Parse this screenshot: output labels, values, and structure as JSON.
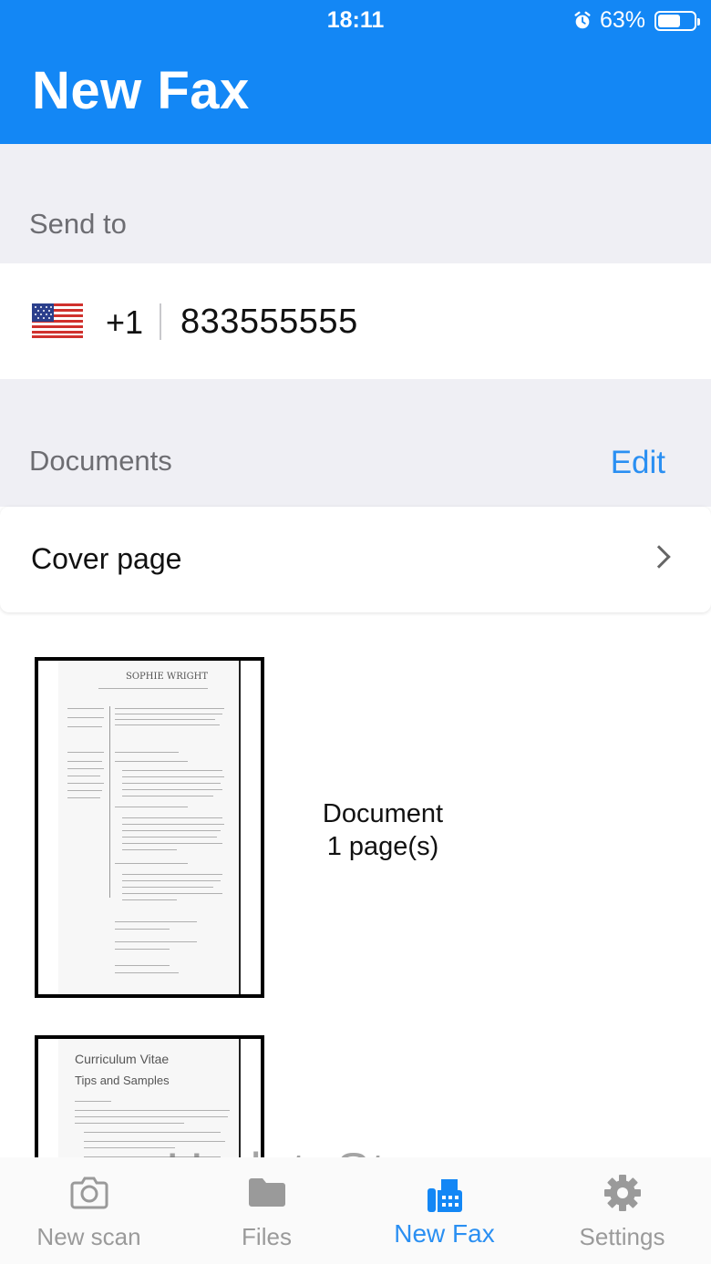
{
  "status_bar": {
    "time": "18:11",
    "battery": "63%",
    "battery_level": 0.63
  },
  "header": {
    "title": "New Fax"
  },
  "send_to": {
    "label": "Send to",
    "country_code": "+1",
    "phone_number": "833555555",
    "flag_icon": "us-flag-icon"
  },
  "documents": {
    "label": "Documents",
    "edit_label": "Edit",
    "cover_page_label": "Cover page",
    "items": [
      {
        "name": "Document",
        "pages": "1 page(s)"
      }
    ],
    "thumb1": {
      "heading": "SOPHIE WRIGHT"
    },
    "thumb2": {
      "heading": "Curriculum Vitae",
      "subheading": "Tips and Samples"
    }
  },
  "tabs": [
    {
      "label": "New scan",
      "icon": "camera-icon",
      "active": false
    },
    {
      "label": "Files",
      "icon": "folder-icon",
      "active": false
    },
    {
      "label": "New Fax",
      "icon": "fax-icon",
      "active": true
    },
    {
      "label": "Settings",
      "icon": "gear-icon",
      "active": false
    }
  ],
  "colors": {
    "accent": "#1387f5",
    "link": "#2a8ff2",
    "inactive": "#9a9a9a",
    "background": "#efeff4"
  },
  "watermark": "UpdateStar.com"
}
